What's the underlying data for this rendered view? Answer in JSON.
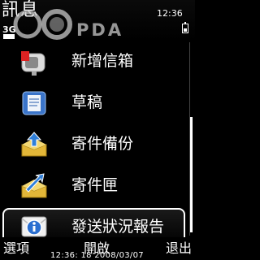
{
  "status": {
    "title": "訊息",
    "network": "3G",
    "clock": "12:36"
  },
  "watermark": {
    "text": "PDA"
  },
  "list": {
    "items": [
      {
        "label": "新增信箱",
        "icon": "new-mailbox-icon"
      },
      {
        "label": "草稿",
        "icon": "drafts-icon"
      },
      {
        "label": "寄件備份",
        "icon": "sent-backup-icon"
      },
      {
        "label": "寄件匣",
        "icon": "outbox-icon"
      },
      {
        "label": "發送狀況報告",
        "icon": "delivery-report-icon",
        "selected": true
      }
    ]
  },
  "softkeys": {
    "left": "選項",
    "middle": "開啟",
    "right": "退出"
  },
  "timestamp": "12:36: 18 2008/03/07"
}
